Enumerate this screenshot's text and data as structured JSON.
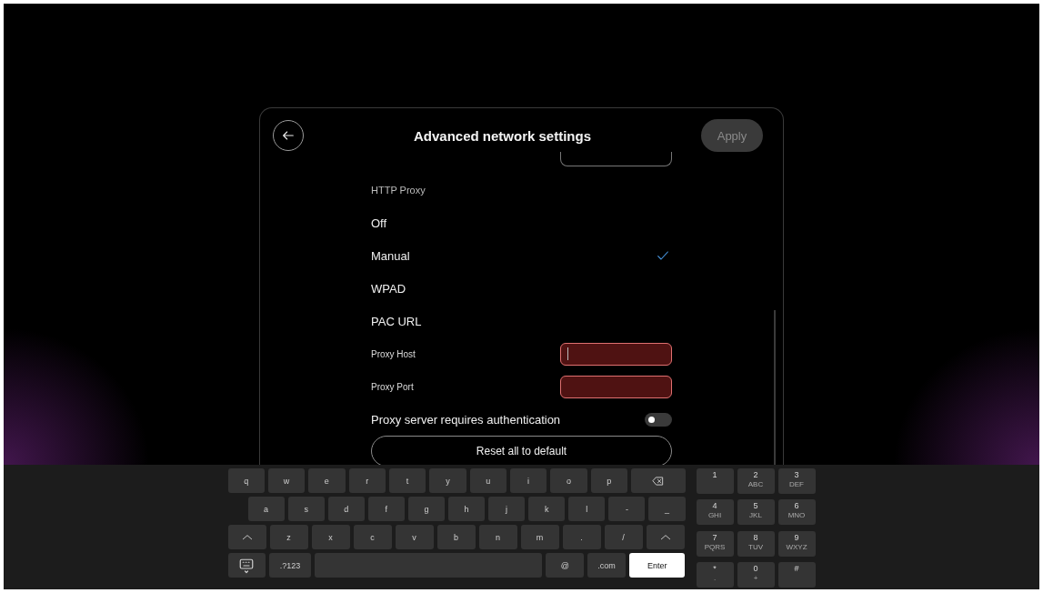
{
  "header": {
    "title": "Advanced network settings",
    "apply": {
      "label": "Apply",
      "disabled": true
    }
  },
  "section_label": "HTTP Proxy",
  "options": [
    {
      "label": "Off",
      "selected": false
    },
    {
      "label": "Manual",
      "selected": true
    },
    {
      "label": "WPAD",
      "selected": false
    },
    {
      "label": "PAC URL",
      "selected": false
    }
  ],
  "fields": [
    {
      "label": "Proxy Host",
      "error": true,
      "focused": true
    },
    {
      "label": "Proxy Port",
      "error": true,
      "focused": false
    }
  ],
  "auth_toggle": {
    "label": "Proxy server requires authentication",
    "on": false
  },
  "reset_button": "Reset all to default",
  "keyboard": {
    "rows": [
      [
        {
          "kind": "char",
          "label": "q"
        },
        {
          "kind": "char",
          "label": "w"
        },
        {
          "kind": "char",
          "label": "e"
        },
        {
          "kind": "char",
          "label": "r"
        },
        {
          "kind": "char",
          "label": "t"
        },
        {
          "kind": "char",
          "label": "y"
        },
        {
          "kind": "char",
          "label": "u"
        },
        {
          "kind": "char",
          "label": "i"
        },
        {
          "kind": "char",
          "label": "o"
        },
        {
          "kind": "char",
          "label": "p"
        },
        {
          "kind": "backspace"
        }
      ],
      [
        {
          "kind": "char",
          "label": "a"
        },
        {
          "kind": "char",
          "label": "s"
        },
        {
          "kind": "char",
          "label": "d"
        },
        {
          "kind": "char",
          "label": "f"
        },
        {
          "kind": "char",
          "label": "g"
        },
        {
          "kind": "char",
          "label": "h"
        },
        {
          "kind": "char",
          "label": "j"
        },
        {
          "kind": "char",
          "label": "k"
        },
        {
          "kind": "char",
          "label": "l"
        },
        {
          "kind": "char",
          "label": "-"
        },
        {
          "kind": "char",
          "label": "_"
        }
      ],
      [
        {
          "kind": "shift"
        },
        {
          "kind": "char",
          "label": "z"
        },
        {
          "kind": "char",
          "label": "x"
        },
        {
          "kind": "char",
          "label": "c"
        },
        {
          "kind": "char",
          "label": "v"
        },
        {
          "kind": "char",
          "label": "b"
        },
        {
          "kind": "char",
          "label": "n"
        },
        {
          "kind": "char",
          "label": "m"
        },
        {
          "kind": "char",
          "label": "."
        },
        {
          "kind": "char",
          "label": "/"
        },
        {
          "kind": "shift"
        }
      ],
      [
        {
          "kind": "hide"
        },
        {
          "kind": "char",
          "label": ".?123"
        },
        {
          "kind": "space"
        },
        {
          "kind": "char",
          "label": "@"
        },
        {
          "kind": "char",
          "label": ".com"
        },
        {
          "kind": "enter",
          "label": "Enter"
        }
      ]
    ],
    "numpad": [
      {
        "digit": "1"
      },
      {
        "digit": "2",
        "letters": "ABC"
      },
      {
        "digit": "3",
        "letters": "DEF"
      },
      {
        "digit": "4",
        "letters": "GHI"
      },
      {
        "digit": "5",
        "letters": "JKL"
      },
      {
        "digit": "6",
        "letters": "MNO"
      },
      {
        "digit": "7",
        "letters": "PQRS"
      },
      {
        "digit": "8",
        "letters": "TUV"
      },
      {
        "digit": "9",
        "letters": "WXYZ"
      },
      {
        "digit": "*",
        "letters": "."
      },
      {
        "digit": "0",
        "letters": "+"
      },
      {
        "digit": "#"
      }
    ]
  }
}
